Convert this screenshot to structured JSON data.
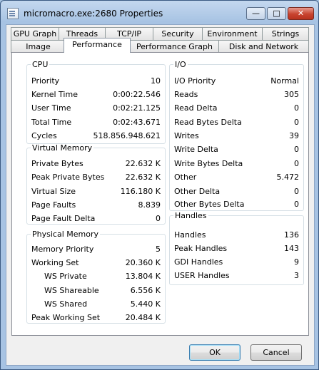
{
  "window": {
    "title": "micromacro.exe:2680 Properties",
    "min": "—",
    "max": "□",
    "close": "✕"
  },
  "tabs_row1": [
    "GPU Graph",
    "Threads",
    "TCP/IP",
    "Security",
    "Environment",
    "Strings"
  ],
  "tabs_row2": [
    "Image",
    "Performance",
    "Performance Graph",
    "Disk and Network"
  ],
  "active_tab": "Performance",
  "cpu": {
    "title": "CPU",
    "rows": [
      {
        "label": "Priority",
        "value": "10"
      },
      {
        "label": "Kernel Time",
        "value": "0:00:22.546"
      },
      {
        "label": "User Time",
        "value": "0:02:21.125"
      },
      {
        "label": "Total Time",
        "value": "0:02:43.671"
      },
      {
        "label": "Cycles",
        "value": "518.856.948.621"
      }
    ]
  },
  "virtual_memory": {
    "title": "Virtual Memory",
    "rows": [
      {
        "label": "Private Bytes",
        "value": "22.632 K"
      },
      {
        "label": "Peak Private Bytes",
        "value": "22.632 K"
      },
      {
        "label": "Virtual Size",
        "value": "116.180 K"
      },
      {
        "label": "Page Faults",
        "value": "8.839"
      },
      {
        "label": "Page Fault Delta",
        "value": "0"
      }
    ]
  },
  "physical_memory": {
    "title": "Physical Memory",
    "rows": [
      {
        "label": "Memory Priority",
        "value": "5"
      },
      {
        "label": "Working Set",
        "value": "20.360 K"
      },
      {
        "label": "WS Private",
        "value": "13.804 K"
      },
      {
        "label": "WS Shareable",
        "value": "6.556 K"
      },
      {
        "label": "WS Shared",
        "value": "5.440 K"
      },
      {
        "label": "Peak Working Set",
        "value": "20.484 K"
      }
    ]
  },
  "io": {
    "title": "I/O",
    "rows": [
      {
        "label": "I/O Priority",
        "value": "Normal"
      },
      {
        "label": "Reads",
        "value": "305"
      },
      {
        "label": "Read Delta",
        "value": "0"
      },
      {
        "label": "Read Bytes Delta",
        "value": "0"
      },
      {
        "label": "Writes",
        "value": "39"
      },
      {
        "label": "Write Delta",
        "value": "0"
      },
      {
        "label": "Write Bytes Delta",
        "value": "0"
      },
      {
        "label": "Other",
        "value": "5.472"
      },
      {
        "label": "Other Delta",
        "value": "0"
      },
      {
        "label": "Other Bytes Delta",
        "value": "0"
      }
    ]
  },
  "handles": {
    "title": "Handles",
    "rows": [
      {
        "label": "Handles",
        "value": "136"
      },
      {
        "label": "Peak Handles",
        "value": "143"
      },
      {
        "label": "GDI Handles",
        "value": "9"
      },
      {
        "label": "USER Handles",
        "value": "3"
      }
    ]
  },
  "buttons": {
    "ok": "OK",
    "cancel": "Cancel"
  }
}
